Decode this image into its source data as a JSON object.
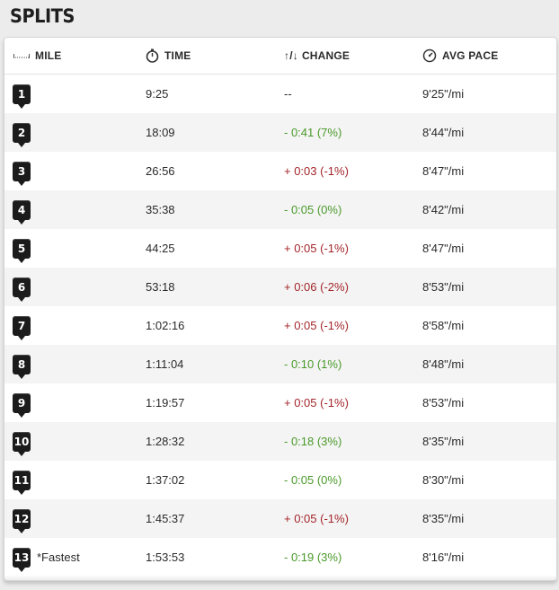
{
  "title": "SPLITS",
  "headers": {
    "mile": "MILE",
    "time": "TIME",
    "change_arrows": "↑/↓",
    "change": "CHANGE",
    "pace": "AVG PACE"
  },
  "colors": {
    "faster": "#4a9a2a",
    "slower": "#a3252a",
    "badge": "#1b1b1b"
  },
  "splits": [
    {
      "mile": "1",
      "note": "",
      "time": "9:25",
      "change": "--",
      "dir": "none",
      "pace": "9'25\"/mi"
    },
    {
      "mile": "2",
      "note": "",
      "time": "18:09",
      "change": "- 0:41 (7%)",
      "dir": "faster",
      "pace": "8'44\"/mi"
    },
    {
      "mile": "3",
      "note": "",
      "time": "26:56",
      "change": "+ 0:03 (-1%)",
      "dir": "slower",
      "pace": "8'47\"/mi"
    },
    {
      "mile": "4",
      "note": "",
      "time": "35:38",
      "change": "- 0:05 (0%)",
      "dir": "faster",
      "pace": "8'42\"/mi"
    },
    {
      "mile": "5",
      "note": "",
      "time": "44:25",
      "change": "+ 0:05 (-1%)",
      "dir": "slower",
      "pace": "8'47\"/mi"
    },
    {
      "mile": "6",
      "note": "",
      "time": "53:18",
      "change": "+ 0:06 (-2%)",
      "dir": "slower",
      "pace": "8'53\"/mi"
    },
    {
      "mile": "7",
      "note": "",
      "time": "1:02:16",
      "change": "+ 0:05 (-1%)",
      "dir": "slower",
      "pace": "8'58\"/mi"
    },
    {
      "mile": "8",
      "note": "",
      "time": "1:11:04",
      "change": "- 0:10 (1%)",
      "dir": "faster",
      "pace": "8'48\"/mi"
    },
    {
      "mile": "9",
      "note": "",
      "time": "1:19:57",
      "change": "+ 0:05 (-1%)",
      "dir": "slower",
      "pace": "8'53\"/mi"
    },
    {
      "mile": "10",
      "note": "",
      "time": "1:28:32",
      "change": "- 0:18 (3%)",
      "dir": "faster",
      "pace": "8'35\"/mi"
    },
    {
      "mile": "11",
      "note": "",
      "time": "1:37:02",
      "change": "- 0:05 (0%)",
      "dir": "faster",
      "pace": "8'30\"/mi"
    },
    {
      "mile": "12",
      "note": "",
      "time": "1:45:37",
      "change": "+ 0:05 (-1%)",
      "dir": "slower",
      "pace": "8'35\"/mi"
    },
    {
      "mile": "13",
      "note": "*Fastest",
      "time": "1:53:53",
      "change": "- 0:19 (3%)",
      "dir": "faster",
      "pace": "8'16\"/mi"
    }
  ]
}
